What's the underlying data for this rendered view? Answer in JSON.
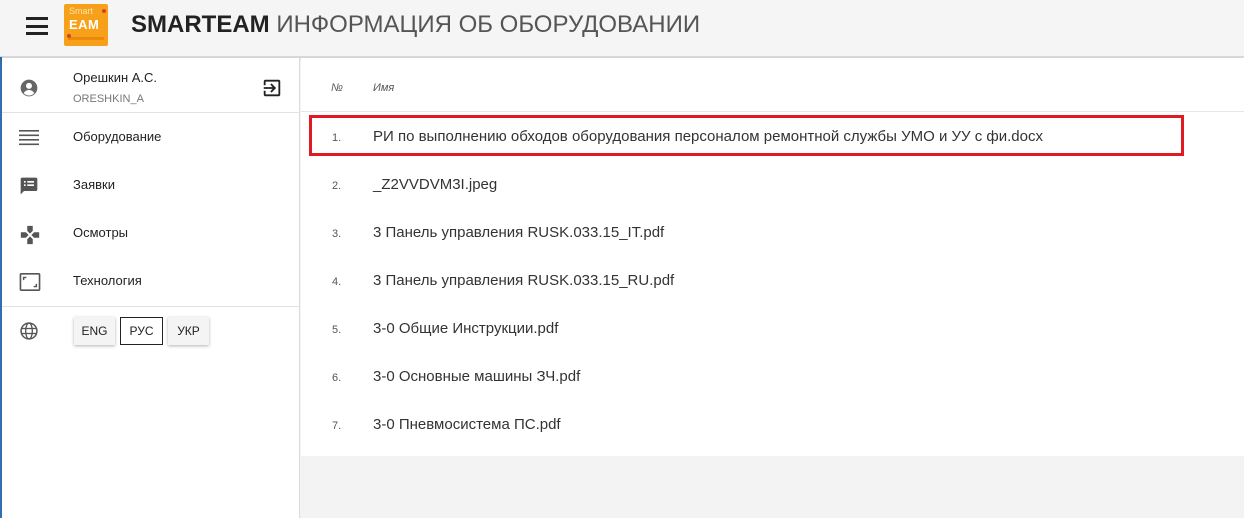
{
  "header": {
    "brand": "SMARTEAM",
    "title_rest": " ИНФОРМАЦИЯ ОБ ОБОРУДОВАНИИ",
    "logo_top": "Smart",
    "logo_main": "EAM"
  },
  "user": {
    "name": "Орешкин А.С.",
    "login": "ORESHKIN_A"
  },
  "nav": [
    {
      "label": "Оборудование",
      "icon": "list-icon"
    },
    {
      "label": "Заявки",
      "icon": "comment-list-icon"
    },
    {
      "label": "Осмотры",
      "icon": "gamepad-icon"
    },
    {
      "label": "Технология",
      "icon": "aspect-ratio-icon"
    }
  ],
  "languages": [
    {
      "label": "ENG",
      "active": false
    },
    {
      "label": "РУС",
      "active": true
    },
    {
      "label": "УКР",
      "active": false
    }
  ],
  "table": {
    "col_num": "№",
    "col_name": "Имя",
    "rows": [
      {
        "num": "1.",
        "name": "РИ по выполнению обходов оборудования персоналом ремонтной службы УМО и УУ с фи.docx"
      },
      {
        "num": "2.",
        "name": "_Z2VVDVM3I.jpeg"
      },
      {
        "num": "3.",
        "name": "3 Панель управления RUSK.033.15_IT.pdf"
      },
      {
        "num": "4.",
        "name": "3 Панель управления RUSK.033.15_RU.pdf"
      },
      {
        "num": "5.",
        "name": "3-0 Общие Инструкции.pdf"
      },
      {
        "num": "6.",
        "name": "3-0 Основные машины ЗЧ.pdf"
      },
      {
        "num": "7.",
        "name": "3-0 Пневмосистема ПС.pdf"
      }
    ]
  },
  "colors": {
    "highlight": "#e01a22",
    "logo": "#f7a11a"
  }
}
